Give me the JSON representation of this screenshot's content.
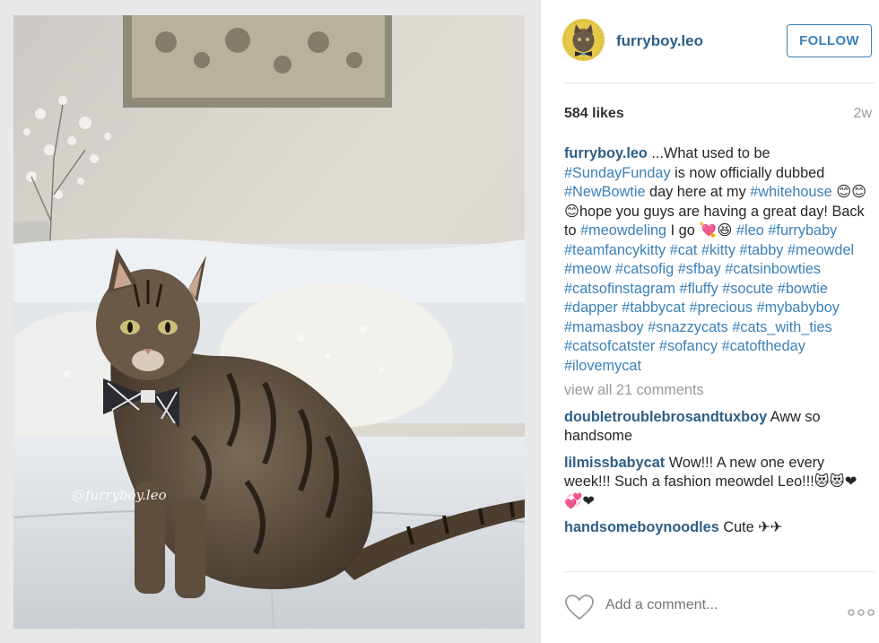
{
  "post": {
    "username": "furryboy.leo",
    "follow_label": "FOLLOW",
    "likes": "584 likes",
    "age": "2w",
    "watermark": "@furryboy.leo"
  },
  "caption": {
    "username": "furryboy.leo",
    "segments": [
      {
        "text": " ...What used to be ",
        "type": "text"
      },
      {
        "text": "#SundayFunday",
        "type": "tag"
      },
      {
        "text": " is now officially dubbed ",
        "type": "text"
      },
      {
        "text": "#NewBowtie",
        "type": "tag"
      },
      {
        "text": " day here at my ",
        "type": "text"
      },
      {
        "text": "#whitehouse",
        "type": "tag"
      },
      {
        "text": " 😊😊😊hope you guys are having a great day! Back to ",
        "type": "text"
      },
      {
        "text": "#meowdeling",
        "type": "tag"
      },
      {
        "text": " I go 💘😆 ",
        "type": "text"
      },
      {
        "text": "#leo",
        "type": "tag"
      },
      {
        "text": " ",
        "type": "text"
      },
      {
        "text": "#furrybaby",
        "type": "tag"
      },
      {
        "text": " ",
        "type": "text"
      },
      {
        "text": "#teamfancykitty",
        "type": "tag"
      },
      {
        "text": " ",
        "type": "text"
      },
      {
        "text": "#cat",
        "type": "tag"
      },
      {
        "text": " ",
        "type": "text"
      },
      {
        "text": "#kitty",
        "type": "tag"
      },
      {
        "text": " ",
        "type": "text"
      },
      {
        "text": "#tabby",
        "type": "tag"
      },
      {
        "text": " ",
        "type": "text"
      },
      {
        "text": "#meowdel",
        "type": "tag"
      },
      {
        "text": " ",
        "type": "text"
      },
      {
        "text": "#meow",
        "type": "tag"
      },
      {
        "text": " ",
        "type": "text"
      },
      {
        "text": "#catsofig",
        "type": "tag"
      },
      {
        "text": " ",
        "type": "text"
      },
      {
        "text": "#sfbay",
        "type": "tag"
      },
      {
        "text": " ",
        "type": "text"
      },
      {
        "text": "#catsinbowties",
        "type": "tag"
      },
      {
        "text": " ",
        "type": "text"
      },
      {
        "text": "#catsofinstagram",
        "type": "tag"
      },
      {
        "text": " ",
        "type": "text"
      },
      {
        "text": "#fluffy",
        "type": "tag"
      },
      {
        "text": " ",
        "type": "text"
      },
      {
        "text": "#socute",
        "type": "tag"
      },
      {
        "text": " ",
        "type": "text"
      },
      {
        "text": "#bowtie",
        "type": "tag"
      },
      {
        "text": " ",
        "type": "text"
      },
      {
        "text": "#dapper",
        "type": "tag"
      },
      {
        "text": " ",
        "type": "text"
      },
      {
        "text": "#tabbycat",
        "type": "tag"
      },
      {
        "text": " ",
        "type": "text"
      },
      {
        "text": "#precious",
        "type": "tag"
      },
      {
        "text": " ",
        "type": "text"
      },
      {
        "text": "#mybabyboy",
        "type": "tag"
      },
      {
        "text": " ",
        "type": "text"
      },
      {
        "text": "#mamasboy",
        "type": "tag"
      },
      {
        "text": " ",
        "type": "text"
      },
      {
        "text": "#snazzycats",
        "type": "tag"
      },
      {
        "text": " ",
        "type": "text"
      },
      {
        "text": "#cats_with_ties",
        "type": "tag"
      },
      {
        "text": " ",
        "type": "text"
      },
      {
        "text": "#catsofcatster",
        "type": "tag"
      },
      {
        "text": " ",
        "type": "text"
      },
      {
        "text": "#sofancy",
        "type": "tag"
      },
      {
        "text": " ",
        "type": "text"
      },
      {
        "text": "#catoftheday",
        "type": "tag"
      },
      {
        "text": " ",
        "type": "text"
      },
      {
        "text": "#ilovemycat",
        "type": "tag"
      }
    ]
  },
  "comments": {
    "view_all": "view all 21 comments",
    "items": [
      {
        "user": "doubletroublebrosandtuxboy",
        "text": " Aww so handsome"
      },
      {
        "user": "lilmissbabycat",
        "text": " Wow!!! A new one every week!!! Such a fashion meowdel Leo!!!😻😻❤💞❤"
      },
      {
        "user": "handsomeboynoodles",
        "text": " Cute ✈✈"
      }
    ]
  },
  "footer": {
    "comment_placeholder": "Add a comment..."
  },
  "colors": {
    "username_blue": "#2d5f86",
    "hashtag_blue": "#3b81b7",
    "muted_gray": "#999999"
  },
  "icons": [
    "heart-icon",
    "more-options-icon"
  ]
}
